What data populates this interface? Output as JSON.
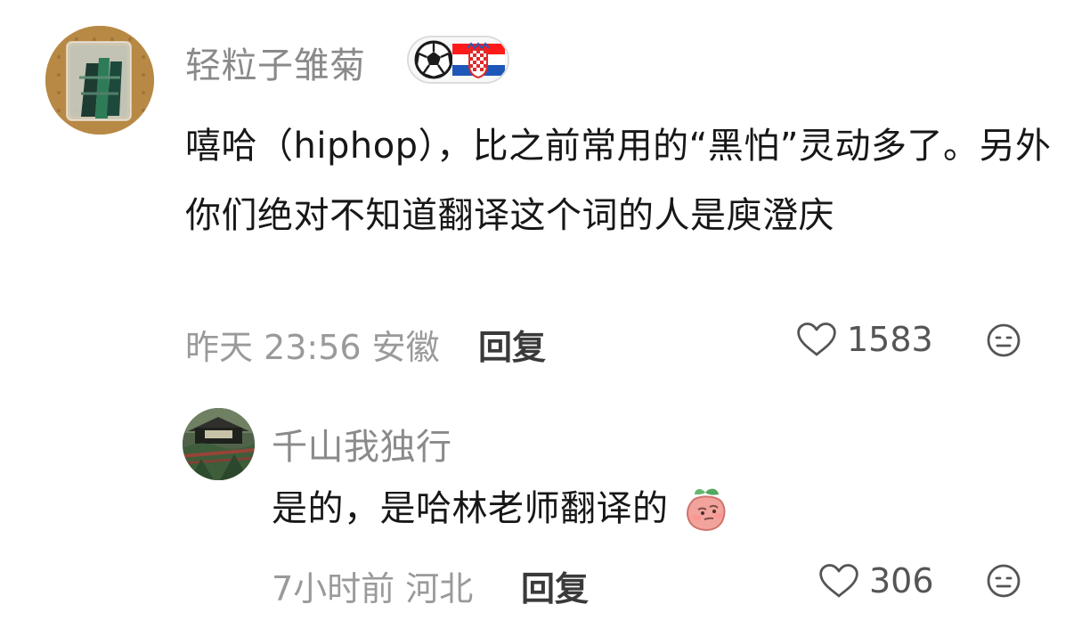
{
  "comments": [
    {
      "username": "轻粒子雏菊",
      "badge": {
        "left_icon": "soccer-ball-icon",
        "right_icon": "croatia-flag-icon"
      },
      "text": "嘻哈（hiphop），比之前常用的“黑怕”灵动多了。另外你们绝对不知道翻译这个词的人是庾澄庆",
      "time_location": "昨天 23:56 安徽",
      "reply_label": "回复",
      "like_count": "1583",
      "reaction_icon": "emoji-face-icon"
    },
    {
      "username": "千山我独行",
      "text": "是的，是哈林老师翻译的",
      "inline_emoji": "peach-emoji-icon",
      "time_location": "7小时前 河北",
      "reply_label": "回复",
      "like_count": "306",
      "reaction_icon": "emoji-face-icon"
    }
  ],
  "colors": {
    "username": "#8a8a8a",
    "text": "#171717",
    "meta": "#9a9a9a",
    "icon": "#555555"
  }
}
